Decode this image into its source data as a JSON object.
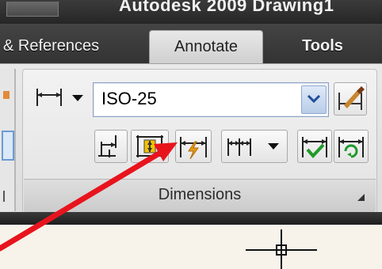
{
  "titlebar": {
    "title": "Autodesk 2009 Drawing1"
  },
  "tabs": [
    {
      "label": "& References",
      "active": false
    },
    {
      "label": "Annotate",
      "active": true
    },
    {
      "label": "Tools",
      "active": false
    }
  ],
  "dimensions_panel": {
    "title": "Dimensions",
    "dim_style": {
      "value": "ISO-25"
    },
    "icons": {
      "linear_dim": "linear-dimension-icon",
      "dim_style_manager": "dimension-style-brush-icon",
      "baseline": "baseline-dimension-icon",
      "dim_space": "dimension-space-icon",
      "dim_break": "dimension-break-icon",
      "continue": "continue-dimension-icon",
      "inspect": "inspect-dimension-icon",
      "update": "update-dimension-icon"
    }
  },
  "annotation": {
    "arrow_color": "#e8141d",
    "target": "dimension-break-button"
  },
  "colors": {
    "accent_orange": "#e49a1a",
    "accent_green": "#1f9a2a",
    "panel_bg": "#e6e6e6",
    "drawing_bg": "#f7f3ea"
  }
}
